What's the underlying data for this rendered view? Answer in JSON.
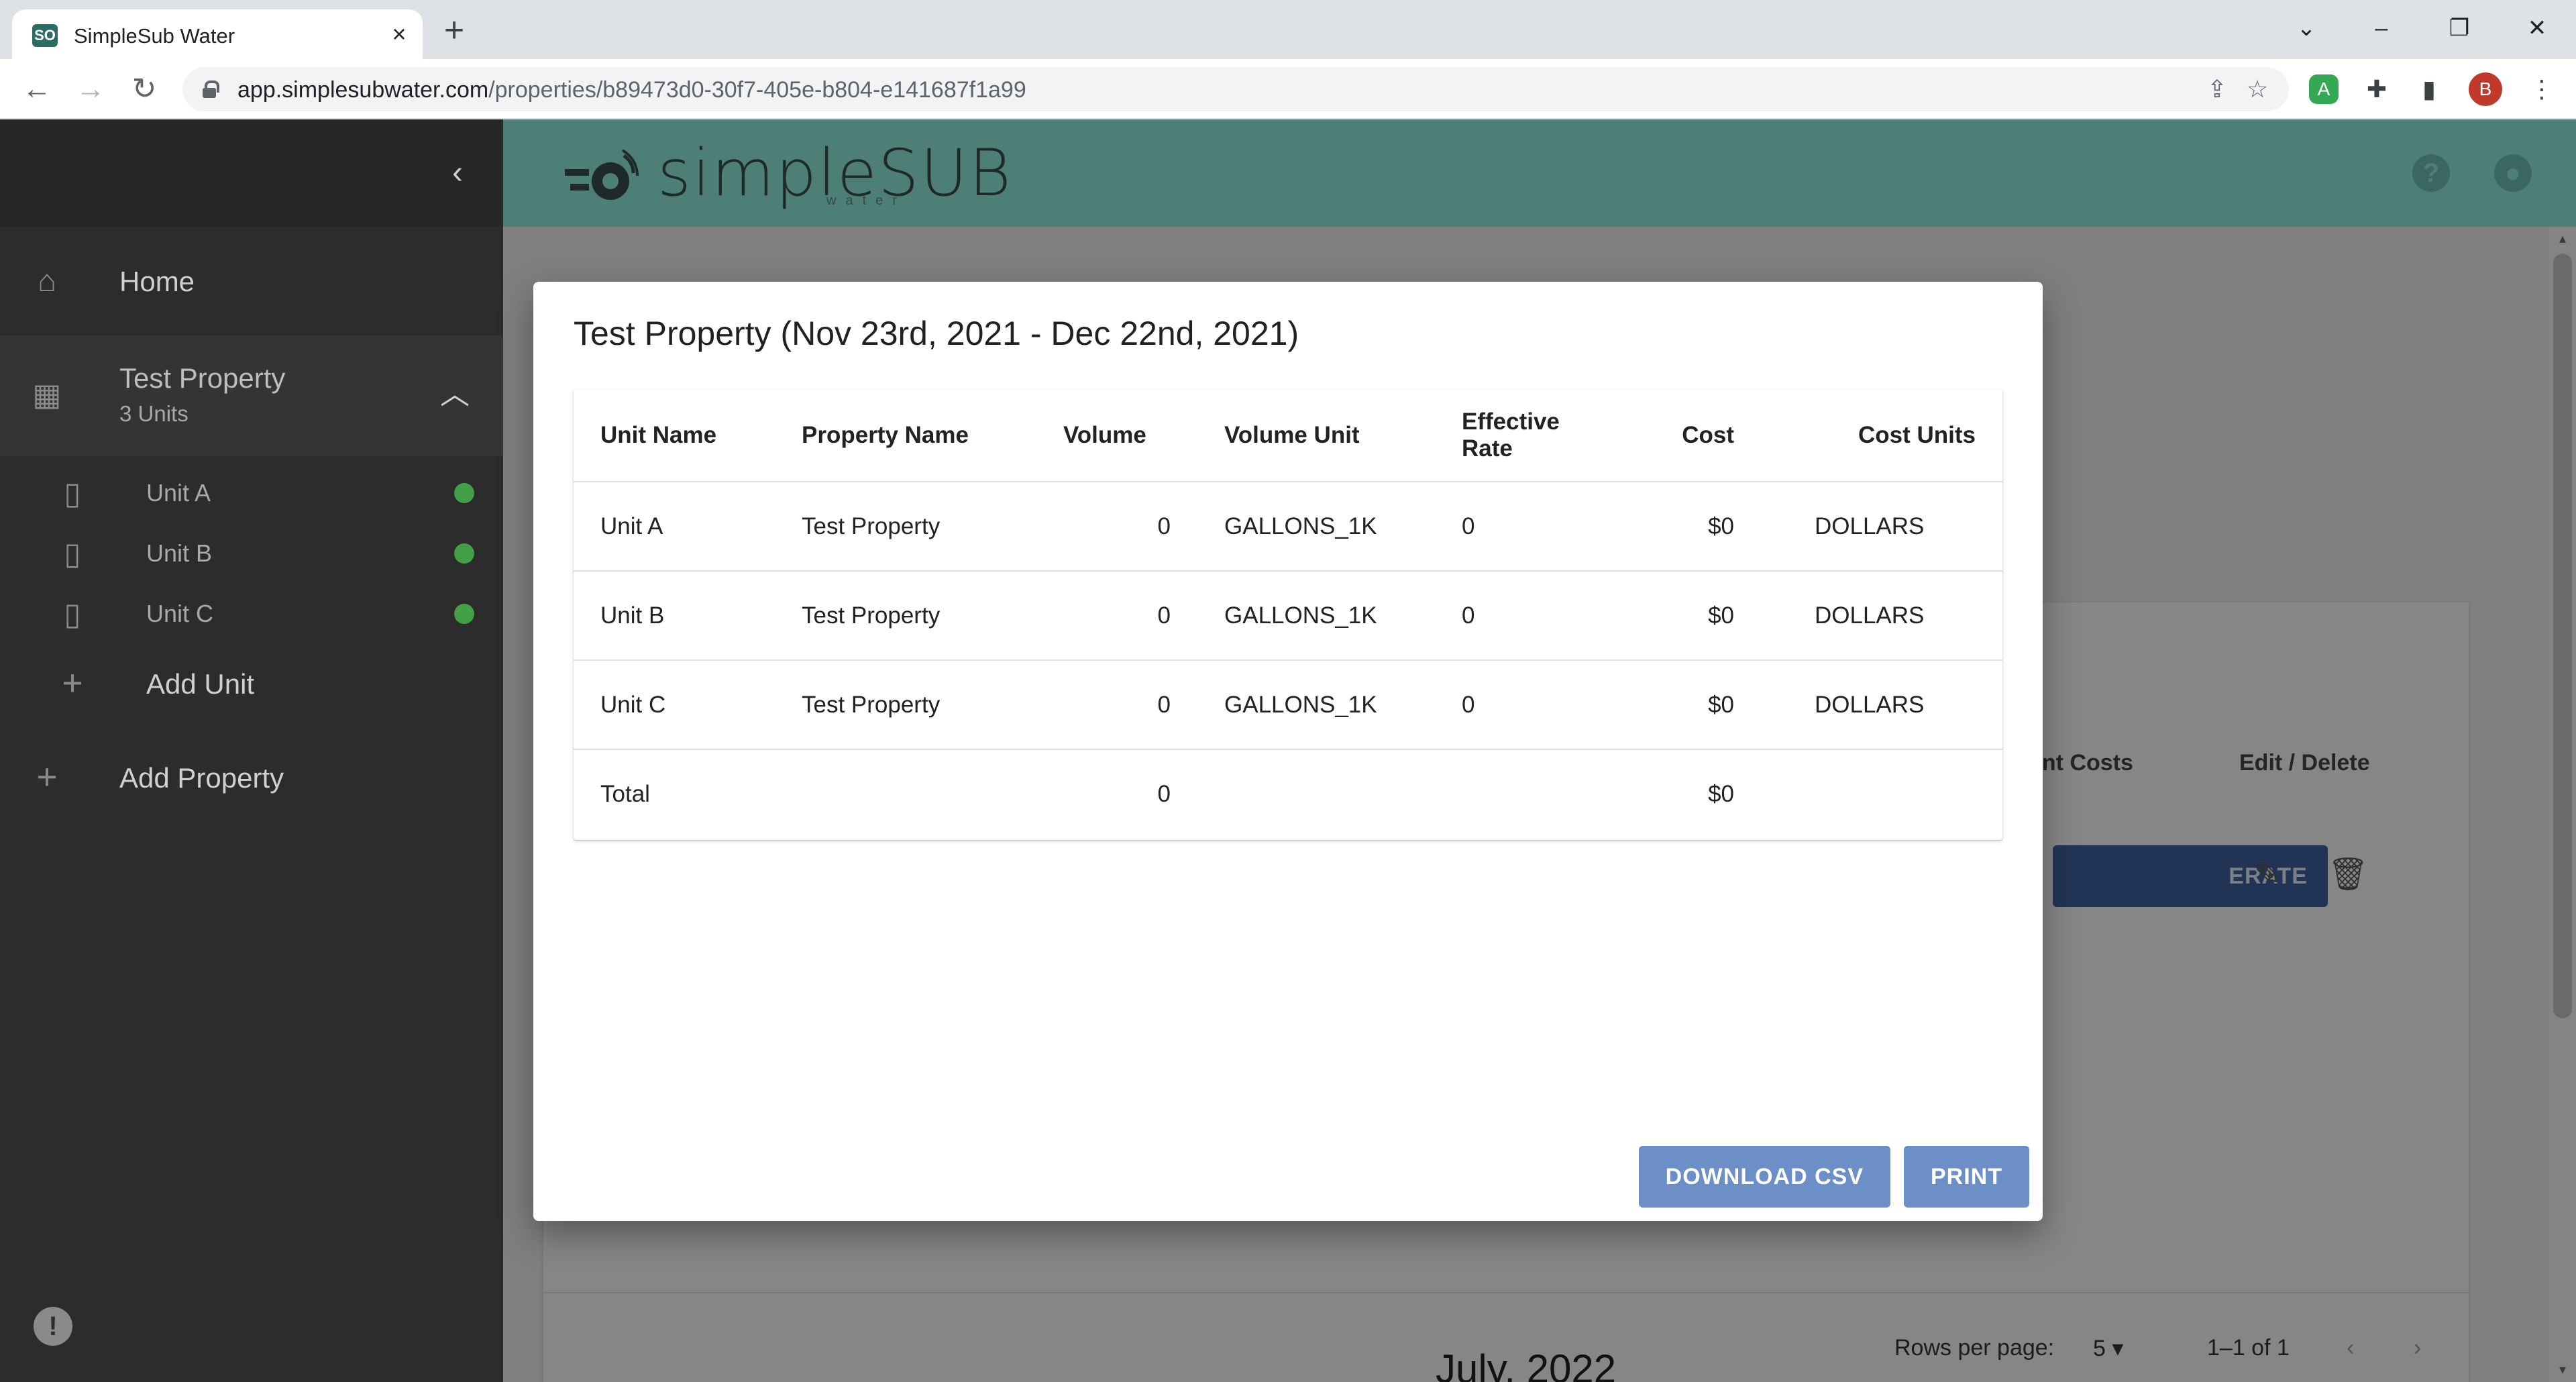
{
  "browser": {
    "tab_title": "SimpleSub Water",
    "url_host": "app.simplesubwater.com",
    "url_path": "/properties/b89473d0-30f7-405e-b804-e141687f1a99",
    "profile_initial": "B"
  },
  "sidebar": {
    "home_label": "Home",
    "property": {
      "name": "Test Property",
      "units_label": "3 Units"
    },
    "units": [
      {
        "label": "Unit A",
        "status_color": "#43a047"
      },
      {
        "label": "Unit B",
        "status_color": "#43a047"
      },
      {
        "label": "Unit C",
        "status_color": "#43a047"
      }
    ],
    "add_unit_label": "Add Unit",
    "add_property_label": "Add Property"
  },
  "appbar": {
    "logo_text": "simpleSUB",
    "logo_subtext": "water"
  },
  "background": {
    "col_tenant_costs": "ant Costs",
    "col_edit_delete": "Edit / Delete",
    "generate_label": "ERATE",
    "rows_per_page_label": "Rows per page:",
    "rows_per_page_value": "5",
    "pagination_range": "1–1 of 1",
    "month_heading": "July, 2022"
  },
  "dialog": {
    "title": "Test Property (Nov 23rd, 2021 - Dec 22nd, 2021)",
    "columns": [
      "Unit Name",
      "Property Name",
      "Volume",
      "Volume Unit",
      "Effective Rate",
      "Cost",
      "Cost Units"
    ],
    "rows": [
      {
        "unit_name": "Unit A",
        "property_name": "Test Property",
        "volume": "0",
        "volume_unit": "GALLONS_1K",
        "effective_rate": "0",
        "cost": "$0",
        "cost_units": "DOLLARS"
      },
      {
        "unit_name": "Unit B",
        "property_name": "Test Property",
        "volume": "0",
        "volume_unit": "GALLONS_1K",
        "effective_rate": "0",
        "cost": "$0",
        "cost_units": "DOLLARS"
      },
      {
        "unit_name": "Unit C",
        "property_name": "Test Property",
        "volume": "0",
        "volume_unit": "GALLONS_1K",
        "effective_rate": "0",
        "cost": "$0",
        "cost_units": "DOLLARS"
      }
    ],
    "total": {
      "label": "Total",
      "volume": "0",
      "cost": "$0"
    },
    "download_csv_label": "DOWNLOAD CSV",
    "print_label": "PRINT"
  },
  "colors": {
    "appbar": "#4e7f76",
    "sidebar": "#2c2c2c",
    "primary_button": "#6b8fc6",
    "status_ok": "#43a047"
  }
}
